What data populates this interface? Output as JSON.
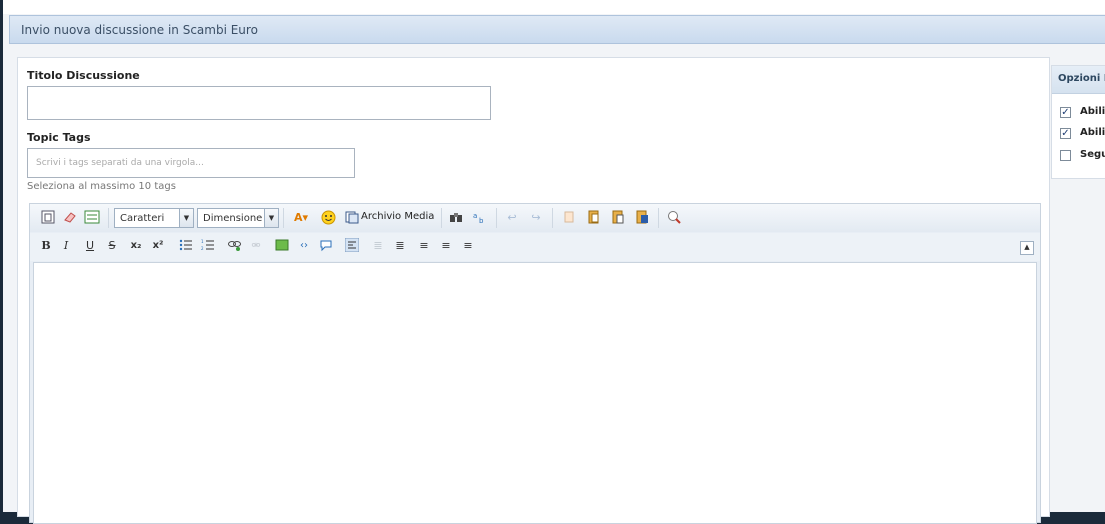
{
  "header": {
    "title": "Invio nuova discussione in Scambi Euro"
  },
  "form": {
    "title_label": "Titolo Discussione",
    "title_value": "",
    "tags_label": "Topic Tags",
    "tags_placeholder": "Scrivi i tags separati da una virgola...",
    "tags_hint": "Seleziona al massimo 10 tags"
  },
  "toolbar": {
    "font_combo": "Caratteri",
    "size_combo": "Dimensione",
    "media_label": "Archivio Media",
    "bold": "B",
    "italic": "I",
    "underline": "U",
    "strike": "S",
    "subscript": "x₂",
    "superscript": "x²"
  },
  "side": {
    "title": "Opzioni M",
    "options": [
      {
        "label": "Abilit",
        "checked": true
      },
      {
        "label": "Abilit",
        "checked": true
      },
      {
        "label": "Segui",
        "checked": false
      }
    ]
  },
  "colors": {
    "accent": "#c9daee",
    "border": "#aec3dc",
    "checkmark": "#1e3d73"
  }
}
